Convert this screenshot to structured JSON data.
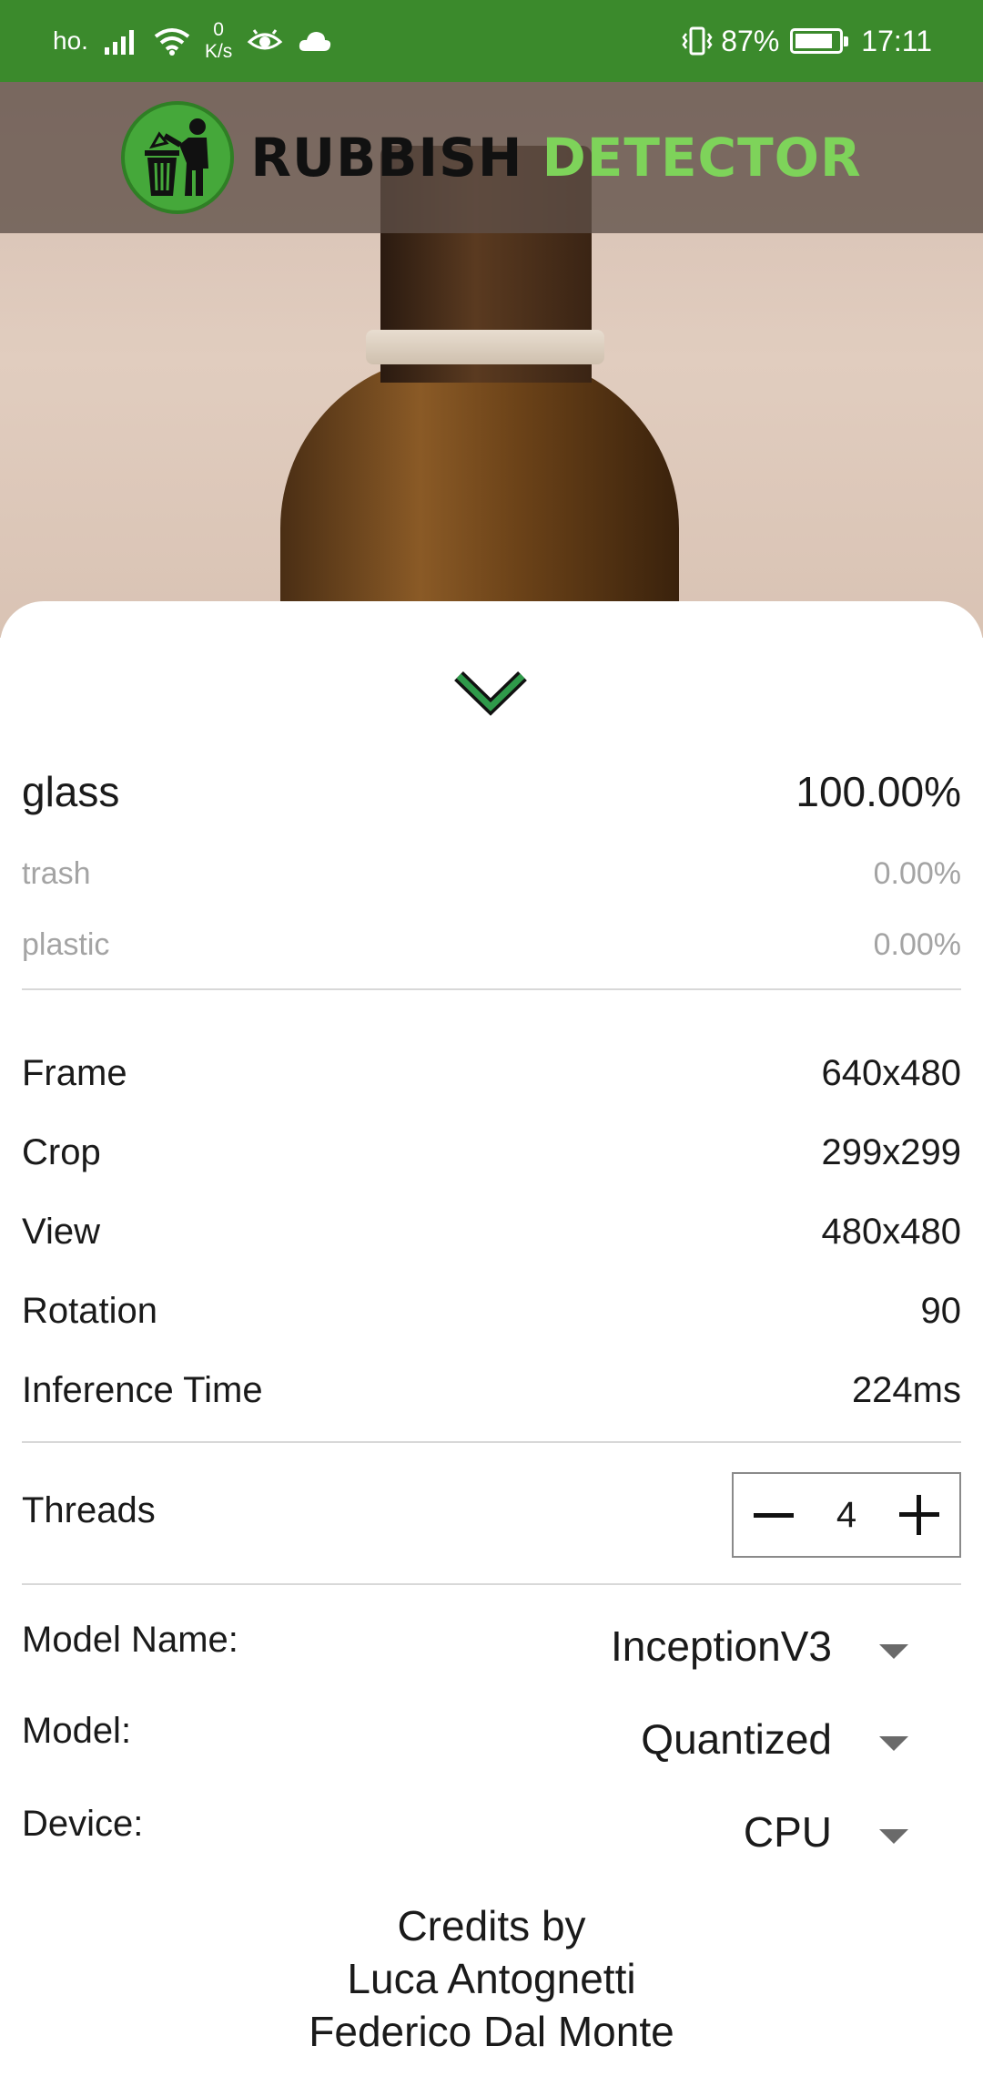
{
  "status_bar": {
    "carrier": "ho.",
    "net_speed_value": "0",
    "net_speed_unit": "K/s",
    "battery_percent": "87%",
    "battery_level": 0.87,
    "time": "17:11",
    "icons": [
      "signal-icon",
      "wifi-icon",
      "eye-icon",
      "cloud-icon",
      "vibrate-icon",
      "battery-icon"
    ]
  },
  "header": {
    "brand_part1": "RUBBISH",
    "brand_part2": "DETECTOR",
    "logo": "trash-person-logo"
  },
  "results": [
    {
      "label": "glass",
      "score": "100.00%"
    },
    {
      "label": "trash",
      "score": "0.00%"
    },
    {
      "label": "plastic",
      "score": "0.00%"
    }
  ],
  "info": [
    {
      "label": "Frame",
      "value": "640x480"
    },
    {
      "label": "Crop",
      "value": "299x299"
    },
    {
      "label": "View",
      "value": "480x480"
    },
    {
      "label": "Rotation",
      "value": "90"
    },
    {
      "label": "Inference Time",
      "value": "224ms"
    }
  ],
  "threads": {
    "label": "Threads",
    "value": "4"
  },
  "selectors": [
    {
      "label": "Model Name:",
      "value": "InceptionV3"
    },
    {
      "label": "Model:",
      "value": "Quantized"
    },
    {
      "label": "Device:",
      "value": "CPU"
    }
  ],
  "credits": {
    "line1": "Credits by",
    "line2": "Luca Antognetti",
    "line3": "Federico Dal Monte"
  },
  "colors": {
    "status_bar": "#3b8a2c",
    "brand_green": "#7ed35a",
    "chevron": "#2f9a4a"
  }
}
